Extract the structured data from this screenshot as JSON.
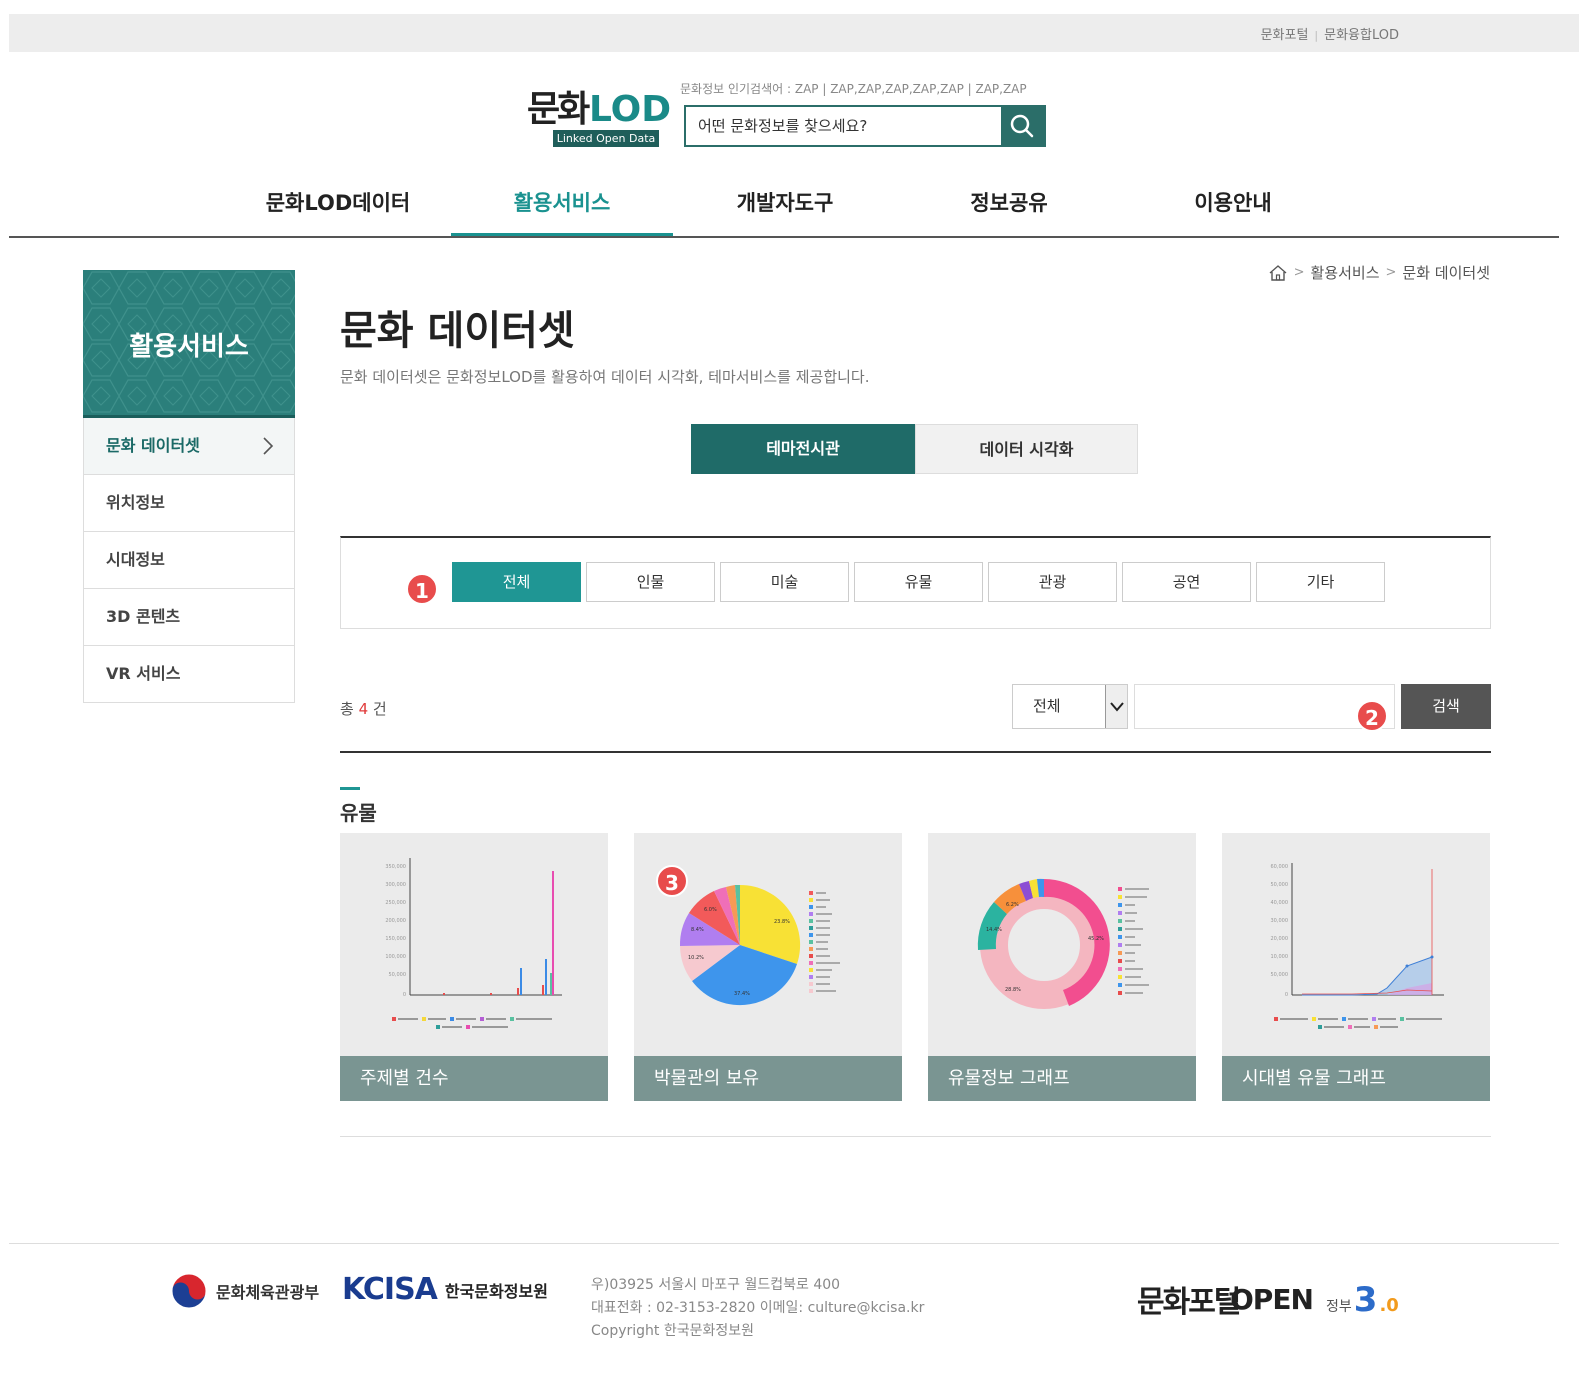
{
  "top_links": [
    "문화포털",
    "문화융합LOD"
  ],
  "logo": {
    "main": "문화",
    "lod": "LOD",
    "tagline": "Linked Open Data"
  },
  "popular": {
    "label": "문화정보 인기검색어 :",
    "terms": "ZAP  |  ZAP,ZAP,ZAP,ZAP,ZAP  |  ZAP,ZAP"
  },
  "search": {
    "placeholder": "어떤 문화정보를 찾으세요?"
  },
  "gnb": [
    "문화LOD데이터",
    "활용서비스",
    "개발자도구",
    "정보공유",
    "이용안내"
  ],
  "sidebar": {
    "title": "활용서비스",
    "items": [
      "문화 데이터셋",
      "위치정보",
      "시대정보",
      "3D 콘텐츠",
      "VR 서비스"
    ]
  },
  "breadcrumb": [
    "활용서비스",
    "문화 데이터셋"
  ],
  "page": {
    "title": "문화 데이터셋",
    "desc": "문화 데이터셋은 문화정보LOD를 활용하여 데이터 시각화, 테마서비스를 제공합니다."
  },
  "tabs": [
    "테마전시관",
    "데이터 시각화"
  ],
  "filters": [
    "전체",
    "인물",
    "미술",
    "유물",
    "관광",
    "공연",
    "기타"
  ],
  "badges": [
    "1",
    "2",
    "3"
  ],
  "list": {
    "total_prefix": "총",
    "total_count": "4",
    "total_suffix": "건",
    "select_value": "전체",
    "search_button": "검색"
  },
  "section_title": "유물",
  "cards": [
    "주제별 건수",
    "박물관의 보유",
    "유물정보 그래프",
    "시대별 유물 그래프"
  ],
  "footer": {
    "ministry": "문화체육관광부",
    "kcisa": "KCISA",
    "kcisa_name": "한국문화정보원",
    "address": "우)03925 서울시 마포구 월드컵북로 400",
    "contact": "대표전화 : 02-3153-2820 이메일: culture@kcisa.kr",
    "copyright": "Copyright 한국문화정보원",
    "portal": "문화포털",
    "open": "OPEN",
    "gov_text": "정부",
    "gov_num": "3",
    "gov_zero": ".0"
  },
  "colors": {
    "accent": "#1f9694",
    "dark_teal": "#1f6b68",
    "badge": "#e84c4c"
  }
}
